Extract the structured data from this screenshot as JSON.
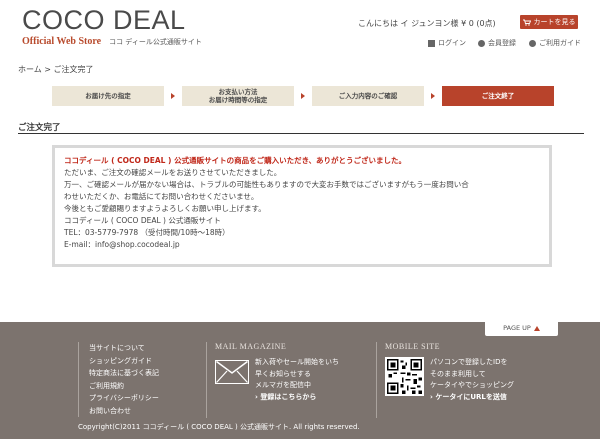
{
  "header": {
    "logo_main": "COCO DEAL",
    "logo_sub_en": "Official Web Store",
    "logo_sub_jp": "ココ ディール公式通販サイト",
    "greeting": "こんにちは イ ジュンヨン様 ¥ 0 (0点)",
    "cart_label": "カートを見る",
    "util_login": "ログイン",
    "util_register": "会員登録",
    "util_guide": "ご利用ガイド"
  },
  "breadcrumb": "ホーム > ご注文完了",
  "steps": [
    {
      "label": "お届け先の指定",
      "active": false
    },
    {
      "label": "お支払い方法\nお届け時間等の指定",
      "active": false
    },
    {
      "label": "ご入力内容のご確認",
      "active": false
    },
    {
      "label": "ご注文終了",
      "active": true
    }
  ],
  "section_title": "ご注文完了",
  "message": {
    "lead": "ココディール ( COCO DEAL ) 公式通販サイトの商品をご購入いただき、ありがとうございました。",
    "lines": [
      "ただいま、ご注文の確認メールをお送りさせていただきました。",
      "万一、ご確認メールが届かない場合は、トラブルの可能性もありますので大変お手数ではございますがもう一度お問い合",
      "わせいただくか、お電話にてお問い合わせくださいませ。",
      "今後ともご愛顧賜りますようよろしくお願い申し上げます。",
      "ココディール ( COCO DEAL ) 公式通販サイト",
      "TEL：03-5779-7978 （受付時間/10時〜18時）",
      "E-mail：info@shop.cocodeal.jp"
    ]
  },
  "footer": {
    "pagetop": "PAGE UP",
    "links": [
      "当サイトについて",
      "ショッピングガイド",
      "特定商法に基づく表記",
      "ご利用規約",
      "プライバシーポリシー",
      "お問い合わせ"
    ],
    "mail_heading": "MAIL MAGAZINE",
    "mail_lines": [
      "新入荷やセール開始をいち",
      "早くお知らせする",
      "メルマガを配信中"
    ],
    "mail_link": "› 登録はこちらから",
    "mobile_heading": "MOBILE SITE",
    "mobile_lines": [
      "パソコンで登録したIDを",
      "そのまま利用して",
      "ケータイやでショッピング"
    ],
    "mobile_link": "› ケータイにURLを送信",
    "copyright": "Copyright(C)2011 ココディール ( COCO DEAL ) 公式通販サイト. All rights reserved."
  }
}
